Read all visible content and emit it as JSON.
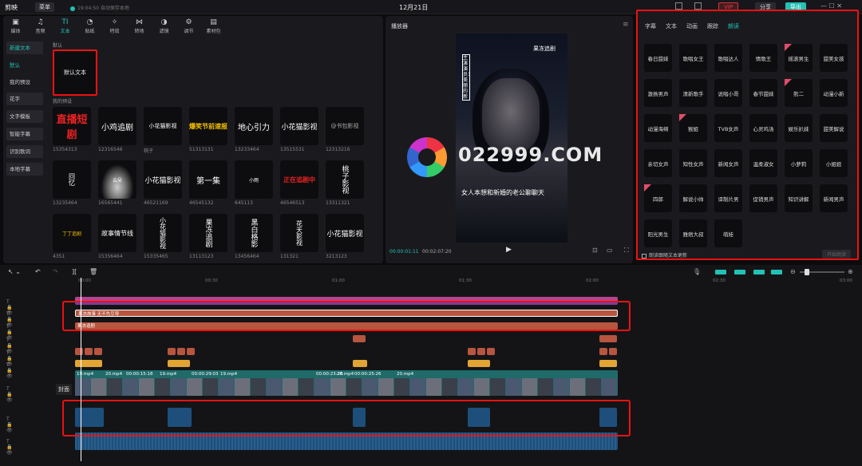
{
  "app": {
    "title": "剪映",
    "menu": "菜单",
    "autosave": "19:04:50 自动保存本地",
    "date": "12月21日",
    "vip": "VIP",
    "share": "分享",
    "export": "导出"
  },
  "tabs": [
    {
      "label": "媒体",
      "icon": "▣"
    },
    {
      "label": "音频",
      "icon": "♫"
    },
    {
      "label": "文本",
      "icon": "TI"
    },
    {
      "label": "贴纸",
      "icon": "◔"
    },
    {
      "label": "特效",
      "icon": "✧"
    },
    {
      "label": "转场",
      "icon": "⋈"
    },
    {
      "label": "滤镜",
      "icon": "◑"
    },
    {
      "label": "调节",
      "icon": "⚙"
    },
    {
      "label": "素材包",
      "icon": "▤"
    }
  ],
  "sidenav": [
    "新建文本",
    "默认",
    "我的预设",
    "花字",
    "文字模板",
    "智能字幕",
    "识别歌词",
    "本地字幕"
  ],
  "sections": {
    "default": "默认",
    "mypresets": "我的预设",
    "default_card": "默认文本"
  },
  "presets": [
    {
      "text": "直播短剧",
      "cap": "15354313"
    },
    {
      "text": "小鸡追剧",
      "cap": "12316546"
    },
    {
      "text": "小花猫影视",
      "cap": "桃子"
    },
    {
      "text": "爆笑节前速报",
      "cap": "51313131"
    },
    {
      "text": "地心引力",
      "cap": "13233464"
    },
    {
      "text": "小花猫影视",
      "cap": "13515531"
    },
    {
      "text": "@书包影视",
      "cap": "12313216"
    },
    {
      "text": "回忆",
      "cap": "13235464"
    },
    {
      "text": "云朵",
      "cap": "16565441"
    },
    {
      "text": "小花猫影视",
      "cap": "46521169"
    },
    {
      "text": "第一集",
      "cap": "46545132"
    },
    {
      "text": "小雨",
      "cap": "645113"
    },
    {
      "text": "正在追剧中",
      "cap": "46546513"
    },
    {
      "text": "桃子影视",
      "cap": "13311321"
    },
    {
      "text": "丁丁追剧",
      "cap": "4351"
    },
    {
      "text": "故事情节线",
      "cap": "15356464"
    },
    {
      "text": "小花猫影视",
      "cap": "15335465"
    },
    {
      "text": "果冻追剧",
      "cap": "13113123"
    },
    {
      "text": "黑白格影",
      "cap": "13456464"
    },
    {
      "text": "花天影视",
      "cap": "131321"
    },
    {
      "text": "小花猫影视",
      "cap": "3213123"
    }
  ],
  "player": {
    "title": "播放器",
    "video_title": "果冻追剧",
    "subtitle": "女人本想和新婚的老公聊聊天",
    "watermark": "022999.COM",
    "vert_text": "主演演员：美丽的新",
    "time_current": "00:00:01:11",
    "time_total": "00:02:07:20"
  },
  "right": {
    "tabs": [
      "字幕",
      "文本",
      "动画",
      "跟踪",
      "朗读"
    ],
    "voices": [
      "春日甜妹",
      "歌唱女王",
      "歌唱达人",
      "情歌王",
      "摇滚男生",
      "甜美女孩",
      "激扬男声",
      "清新歌手",
      "说唱小哥",
      "春节甜妹",
      "熊二",
      "动漫小新",
      "动漫海绵",
      "猴姐",
      "TVB女声",
      "心灵鸡汤",
      "娱乐扒妹",
      "甜美解说",
      "亲切女声",
      "知性女声",
      "新闻女声",
      "温柔淑女",
      "小萝莉",
      "小姐姐",
      "四郎",
      "解说小帅",
      "译制片男",
      "促销男声",
      "知识讲解",
      "新闻男声",
      "阳光男生",
      "雅痞大叔",
      "萌娃"
    ],
    "flagged": [
      4,
      10,
      13,
      24
    ],
    "lang_check": "朗读跟随文本更新",
    "start": "开始朗读"
  },
  "timeline": {
    "ticks": [
      "00:00",
      "00:30",
      "01:00",
      "01:30",
      "02:00",
      "02:30",
      "03:00"
    ],
    "cover": "封面",
    "text_track1": "果冻故事 无不先引导",
    "text_track2": "果冻追剧",
    "clip_labels": [
      "19.mp4",
      "20.mp4",
      "00:00:15:18",
      "19.mp4",
      "00:00:29:03",
      "19.mp4",
      "00:00:23:28",
      "20.mp4",
      "00:00:25:26",
      "20.mp4"
    ]
  }
}
